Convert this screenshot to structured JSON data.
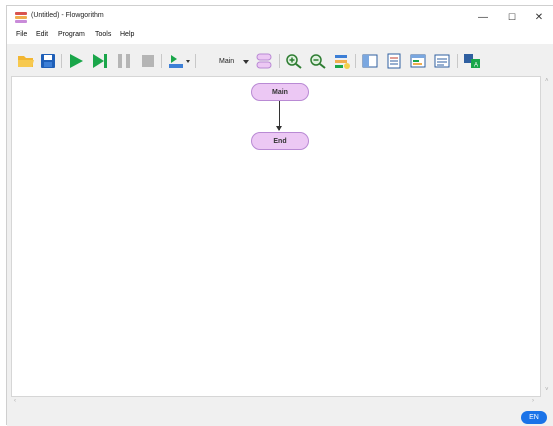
{
  "window": {
    "title": "(Untitled) - Flowgorithm"
  },
  "controls": {
    "minimize": "—",
    "maximize": "☐",
    "close": "✕"
  },
  "menu": [
    "File",
    "Edit",
    "Program",
    "Tools",
    "Help"
  ],
  "toolbar": {
    "function_select": "Main",
    "icons": [
      "open-icon",
      "save-icon",
      "run-icon",
      "step-icon",
      "pause-icon",
      "stop-icon",
      "variable-watch-icon",
      "function-icon",
      "zoom-in-icon",
      "zoom-out-icon",
      "chart-icon",
      "layout-panel-icon",
      "source-code-icon",
      "console-icon",
      "layout-icon",
      "translate-icon"
    ]
  },
  "flowchart": {
    "start_label": "Main",
    "end_label": "End"
  },
  "status": {
    "language": "EN"
  },
  "colors": {
    "node_fill": "#ecc8f4",
    "node_border": "#b98ad4",
    "run_green": "#1aa64a",
    "badge_blue": "#1a73e8"
  }
}
